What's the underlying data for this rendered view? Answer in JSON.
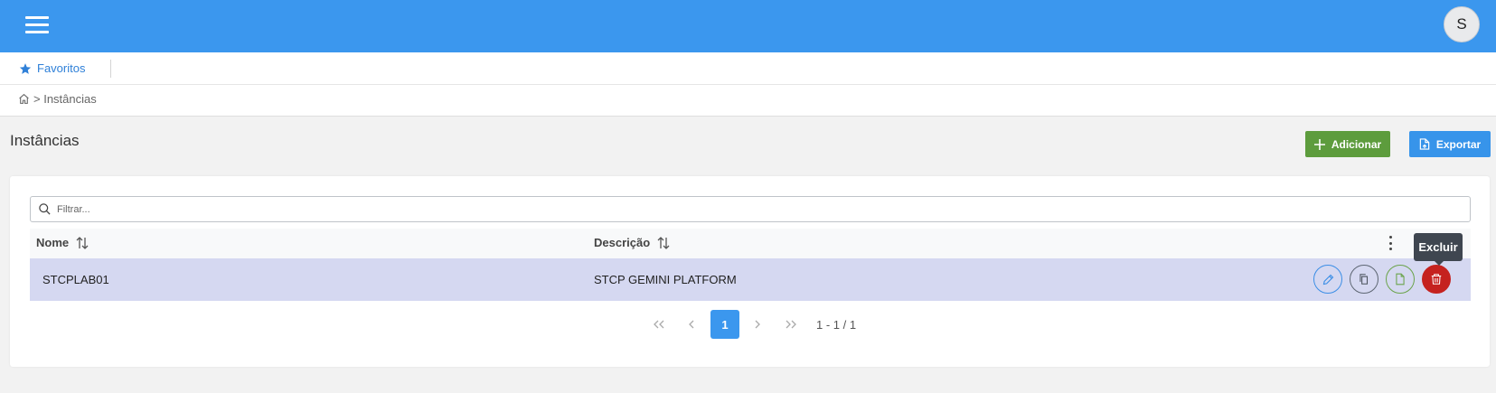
{
  "header": {
    "user_initial": "S",
    "brand_color": "#3b97ee"
  },
  "favorites": {
    "label": "Favoritos"
  },
  "breadcrumb": {
    "separator": ">",
    "current": "Instâncias"
  },
  "page": {
    "title": "Instâncias"
  },
  "toolbar": {
    "add_label": "Adicionar",
    "export_label": "Exportar",
    "add_color": "#5d9c3d",
    "export_color": "#3794ea"
  },
  "filter": {
    "placeholder": "Filtrar...",
    "value": ""
  },
  "table": {
    "columns": [
      {
        "label": "Nome"
      },
      {
        "label": "Descrição"
      }
    ],
    "rows": [
      {
        "nome": "STCPLAB01",
        "descricao": "STCP GEMINI PLATFORM"
      }
    ],
    "row_actions": [
      "pencil-icon",
      "copy-icon",
      "document-icon",
      "trash-icon"
    ]
  },
  "tooltip": {
    "text": "Excluir"
  },
  "pagination": {
    "current_page": "1",
    "info": "1 - 1 / 1"
  }
}
